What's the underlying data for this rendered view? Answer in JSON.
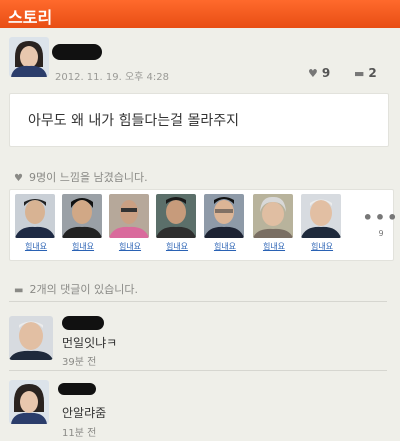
{
  "header": {
    "title": "스토리"
  },
  "post": {
    "timestamp": "2012. 11. 19. 오후 4:28",
    "like_count": "9",
    "comment_count": "2",
    "text": "아무도 왜 내가 힘들다는걸 몰라주지"
  },
  "likes": {
    "heading": "9명이 느낌을 남겼습니다.",
    "label": "힘내요",
    "more_count": "9",
    "people": [
      {
        "label": "힘내요"
      },
      {
        "label": "힘내요"
      },
      {
        "label": "힘내요"
      },
      {
        "label": "힘내요"
      },
      {
        "label": "힘내요"
      },
      {
        "label": "힘내요"
      },
      {
        "label": "힘내요"
      }
    ]
  },
  "comments": {
    "heading": "2개의 댓글이 있습니다.",
    "items": [
      {
        "text": "먼일잇냐ㅋ",
        "time": "39분 전"
      },
      {
        "text": "안알랴줌",
        "time": "11분 전"
      }
    ]
  },
  "icons": {
    "heart": "heart-icon",
    "comment": "comment-bubble-icon",
    "more": "ellipsis-icon"
  },
  "colors": {
    "accent": "#f05a1e",
    "link": "#2a62b4"
  }
}
